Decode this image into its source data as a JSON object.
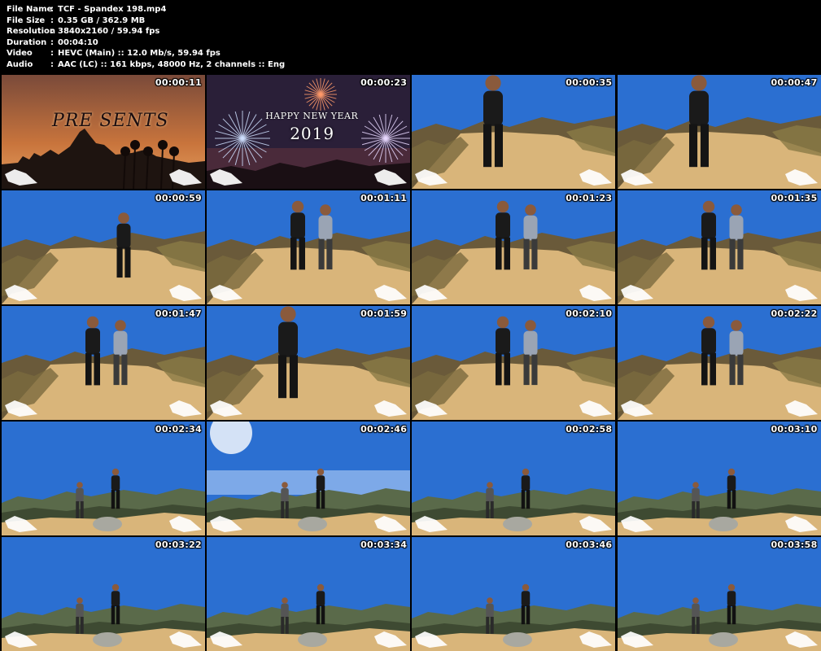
{
  "file_info": [
    {
      "label": "File Name",
      "value": "TCF - Spandex 198.mp4"
    },
    {
      "label": "File Size",
      "value": "0.35 GB / 362.9 MB"
    },
    {
      "label": "Resolution",
      "value": "3840x2160 / 59.94 fps"
    },
    {
      "label": "Duration",
      "value": "00:04:10"
    },
    {
      "label": "Video",
      "value": "HEVC (Main) :: 12.0 Mb/s, 59.94 fps"
    },
    {
      "label": "Audio",
      "value": "AAC (LC) :: 161 kbps, 48000 Hz, 2 channels :: Eng"
    }
  ],
  "separator": ":",
  "thumbnails": [
    {
      "time": "00:00:11",
      "scene": "intro-sunset"
    },
    {
      "time": "00:00:23",
      "scene": "intro-fireworks"
    },
    {
      "time": "00:00:35",
      "scene": "trail-close"
    },
    {
      "time": "00:00:47",
      "scene": "trail-close"
    },
    {
      "time": "00:00:59",
      "scene": "trail-far"
    },
    {
      "time": "00:01:11",
      "scene": "trail-mid"
    },
    {
      "time": "00:01:23",
      "scene": "trail-mid"
    },
    {
      "time": "00:01:35",
      "scene": "trail-mid"
    },
    {
      "time": "00:01:47",
      "scene": "trail-mid"
    },
    {
      "time": "00:01:59",
      "scene": "trail-close"
    },
    {
      "time": "00:02:10",
      "scene": "trail-mid"
    },
    {
      "time": "00:02:22",
      "scene": "trail-mid"
    },
    {
      "time": "00:02:34",
      "scene": "summit"
    },
    {
      "time": "00:02:46",
      "scene": "summit-sun"
    },
    {
      "time": "00:02:58",
      "scene": "summit"
    },
    {
      "time": "00:03:10",
      "scene": "summit"
    },
    {
      "time": "00:03:22",
      "scene": "summit"
    },
    {
      "time": "00:03:34",
      "scene": "summit"
    },
    {
      "time": "00:03:46",
      "scene": "summit"
    },
    {
      "time": "00:03:58",
      "scene": "summit"
    }
  ],
  "intro_text": {
    "presents": "PRE SENTS",
    "greeting": "HAPPY NEW YEAR",
    "year": "2019"
  },
  "colors": {
    "background": "#000000",
    "header_text": "#ffffff",
    "sky": "#2b6fd1",
    "trail": "#d9b57a",
    "sunset": "#c8743c",
    "night": "#2a1f38"
  }
}
